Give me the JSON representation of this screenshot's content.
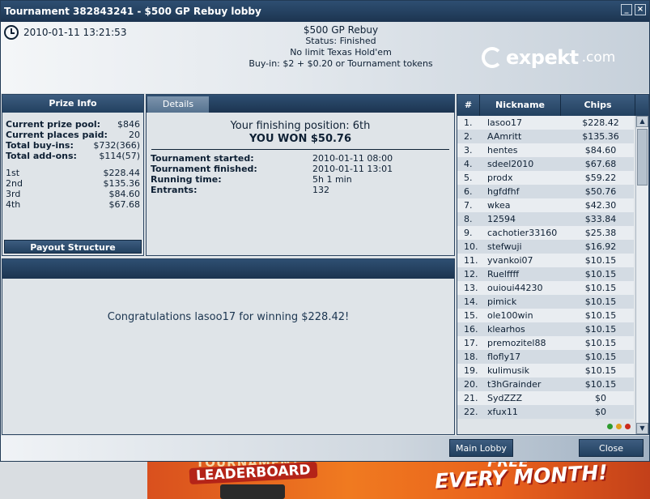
{
  "window": {
    "title": "Tournament 382843241 - $500 GP Rebuy lobby",
    "buttons": [
      "minimize-icon",
      "close-icon"
    ]
  },
  "header": {
    "datetime": "2010-01-11  13:21:53",
    "name": "$500 GP Rebuy",
    "status": "Status: Finished",
    "game": "No limit Texas Hold'em",
    "buyin": "Buy-in: $2 + $0.20 or Tournament tokens",
    "logo": {
      "main": "expekt",
      "suffix": ".com"
    }
  },
  "prize_info": {
    "title": "Prize Info",
    "summary": [
      {
        "label": "Current prize pool:",
        "value": "$846"
      },
      {
        "label": "Current places paid:",
        "value": "20"
      },
      {
        "label": "Total buy-ins:",
        "value": "$732(366)"
      },
      {
        "label": "Total add-ons:",
        "value": "$114(57)"
      }
    ],
    "places": [
      {
        "label": "1st",
        "value": "$228.44"
      },
      {
        "label": "2nd",
        "value": "$135.36"
      },
      {
        "label": "3rd",
        "value": "$84.60"
      },
      {
        "label": "4th",
        "value": "$67.68"
      }
    ],
    "payout_button": "Payout Structure"
  },
  "details": {
    "tab": "Details",
    "finishing": "Your finishing position: 6th",
    "won": "YOU WON $50.76",
    "rows": [
      {
        "label": "Tournament started:",
        "value": "2010-01-11 08:00"
      },
      {
        "label": "Tournament finished:",
        "value": "2010-01-11 13:01"
      },
      {
        "label": "Running time:",
        "value": "5h 1 min"
      },
      {
        "label": "Entrants:",
        "value": "132"
      }
    ]
  },
  "congrats": "Congratulations lasoo17 for winning $228.42!",
  "players": {
    "headers": {
      "num": "#",
      "nick": "Nickname",
      "chips": "Chips"
    },
    "rows": [
      {
        "n": "1.",
        "nick": "lasoo17",
        "chips": "$228.42"
      },
      {
        "n": "2.",
        "nick": "AAmritt",
        "chips": "$135.36"
      },
      {
        "n": "3.",
        "nick": "hentes",
        "chips": "$84.60"
      },
      {
        "n": "4.",
        "nick": "sdeel2010",
        "chips": "$67.68"
      },
      {
        "n": "5.",
        "nick": "prodx",
        "chips": "$59.22"
      },
      {
        "n": "6.",
        "nick": "hgfdfhf",
        "chips": "$50.76"
      },
      {
        "n": "7.",
        "nick": "wkea",
        "chips": "$42.30"
      },
      {
        "n": "8.",
        "nick": "12594",
        "chips": "$33.84"
      },
      {
        "n": "9.",
        "nick": "cachotier33160",
        "chips": "$25.38"
      },
      {
        "n": "10.",
        "nick": "stefwuji",
        "chips": "$16.92"
      },
      {
        "n": "11.",
        "nick": "yvankoi07",
        "chips": "$10.15"
      },
      {
        "n": "12.",
        "nick": "Ruelffff",
        "chips": "$10.15"
      },
      {
        "n": "13.",
        "nick": "ouioui44230",
        "chips": "$10.15"
      },
      {
        "n": "14.",
        "nick": "pimick",
        "chips": "$10.15"
      },
      {
        "n": "15.",
        "nick": "ole100win",
        "chips": "$10.15"
      },
      {
        "n": "16.",
        "nick": "klearhos",
        "chips": "$10.15"
      },
      {
        "n": "17.",
        "nick": "premozitel88",
        "chips": "$10.15"
      },
      {
        "n": "18.",
        "nick": "flofly17",
        "chips": "$10.15"
      },
      {
        "n": "19.",
        "nick": "kulimusik",
        "chips": "$10.15"
      },
      {
        "n": "20.",
        "nick": "t3hGrainder",
        "chips": "$10.15"
      },
      {
        "n": "21.",
        "nick": "SydZZZ",
        "chips": "$0"
      },
      {
        "n": "22.",
        "nick": "xfux11",
        "chips": "$0"
      }
    ],
    "status_dots": [
      "#2e9b2e",
      "#e0a020",
      "#cc2a1c"
    ]
  },
  "footer": {
    "main_lobby": "Main Lobby",
    "close": "Close"
  },
  "banner": {
    "left_top": "TOURNAMENT",
    "left": "LEADERBOARD",
    "right_top": "FREE",
    "right": "EVERY MONTH!"
  }
}
